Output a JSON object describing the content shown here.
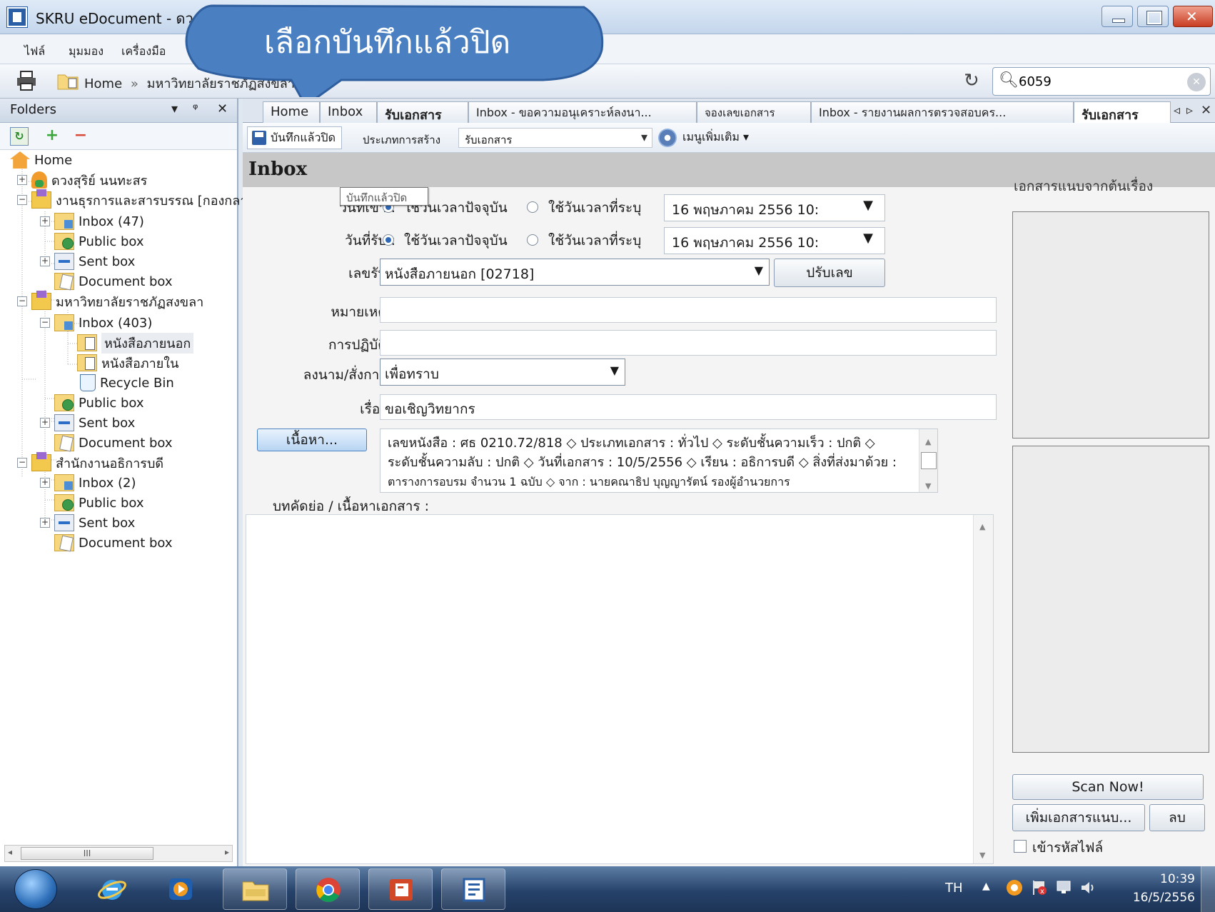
{
  "window": {
    "title": "SKRU eDocument - ดวงสุริย์ นนทะสร"
  },
  "menu": [
    "ไฟล์",
    "มุมมอง",
    "เครื่องมือ"
  ],
  "address": {
    "home": "Home",
    "separator": "»",
    "path": "มหาวิทยาลัยราชภัฏสงขลา",
    "search_value": "6059"
  },
  "callout": {
    "text": "เลือกบันทึกแล้วปิด"
  },
  "tooltip": "บันทึกแล้วปิด",
  "folders": {
    "title": "Folders",
    "tree": [
      {
        "label": "Home",
        "icon": "home-icon"
      },
      {
        "label": "ดวงสุริย์ นนทะสร",
        "icon": "user-icon"
      },
      {
        "label": "งานธุรการและสารบรรณ [กองกลาง]",
        "icon": "group-folder-icon"
      },
      {
        "label": "Inbox (47)",
        "icon": "inbox-icon"
      },
      {
        "label": "Public box",
        "icon": "public-box-icon"
      },
      {
        "label": "Sent box",
        "icon": "sent-box-icon"
      },
      {
        "label": "Document box",
        "icon": "document-box-icon"
      },
      {
        "label": "มหาวิทยาลัยราชภัฏสงขลา",
        "icon": "group-folder-icon"
      },
      {
        "label": "Inbox (403)",
        "icon": "inbox-icon"
      },
      {
        "label": "หนังสือภายนอก",
        "icon": "page-folder-icon"
      },
      {
        "label": "หนังสือภายใน",
        "icon": "page-folder-icon"
      },
      {
        "label": "Recycle Bin",
        "icon": "recycle-bin-icon"
      },
      {
        "label": "Public box",
        "icon": "public-box-icon"
      },
      {
        "label": "Sent box",
        "icon": "sent-box-icon"
      },
      {
        "label": "Document box",
        "icon": "document-box-icon"
      },
      {
        "label": "สำนักงานอธิการบดี",
        "icon": "group-folder-icon"
      },
      {
        "label": "Inbox (2)",
        "icon": "inbox-icon"
      },
      {
        "label": "Public box",
        "icon": "public-box-icon"
      },
      {
        "label": "Sent box",
        "icon": "sent-box-icon"
      },
      {
        "label": "Document box",
        "icon": "document-box-icon"
      }
    ],
    "hscroll_label": "III"
  },
  "tabs": [
    {
      "label": "Home"
    },
    {
      "label": "Inbox"
    },
    {
      "label": "รับเอกสาร"
    },
    {
      "label": "Inbox - ขอความอนุเคราะห์ลงนา..."
    },
    {
      "label": "จองเลขเอกสาร"
    },
    {
      "label": "Inbox - รายงานผลการตรวจสอบคร..."
    },
    {
      "label": "รับเอกสาร",
      "active": true
    }
  ],
  "toolbar": {
    "save_close": "บันทึกแล้วปิด",
    "create_type_label": "ประเภทการสร้าง",
    "create_type_value": "รับเอกสาร",
    "more_menu": "เมนูเพิ่มเติม"
  },
  "inbox_title": "Inbox",
  "form": {
    "date_in_label": "วันที่เข้า :",
    "date_recv_label": "วันที่รับ :",
    "use_now": "ใช้วันเวลาปัจจุบัน",
    "use_specified": "ใช้วันเวลาที่ระบุ",
    "date_in_value": "16  พฤษภาคม  2556  10:",
    "date_recv_value": "16  พฤษภาคม  2556  10:",
    "recv_no_label": "เลขรับ :",
    "recv_no_value": "หนังสือภายนอก [02718]",
    "adjust_no_button": "ปรับเลข",
    "note_label": "หมายเหตุ :",
    "note_value": "",
    "action_label": "การปฏิบัติ :",
    "action_value": "",
    "sign_label": "ลงนาม/สั่งการ :",
    "sign_value": "เพื่อทราบ",
    "subject_label": "เรื่อง :",
    "subject_value": "ขอเชิญวิทยากร",
    "content_button": "เนื้อหา...",
    "metadata_lines": [
      "เลขหนังสือ : ศธ 0210.72/818 ◇ ประเภทเอกสาร : ทั่วไป ◇ ระดับชั้นความเร็ว : ปกติ ◇",
      "ระดับชั้นความลับ : ปกติ ◇ วันที่เอกสาร : 10/5/2556 ◇ เรียน : อธิการบดี ◇ สิ่งที่ส่งมาด้วย :",
      "ตารางการอบรม จำนวน  1  ฉบับ ◇ จาก : นายคณาธิป  บุญญารัตน์ รองผู้อำนวยการ"
    ],
    "body_label": "บทคัดย่อ / เนื้อหาเอกสาร :"
  },
  "attachments": {
    "title": "เอกสารแนบจากต้นเรื่อง",
    "scan_button": "Scan Now!",
    "add_button": "เพิ่มเอกสารแนบ...",
    "delete_button": "ลบ",
    "encrypt_label": "เข้ารหัสไฟล์"
  },
  "taskbar": {
    "lang": "TH",
    "time": "10:39",
    "date": "16/5/2556"
  },
  "colors": {
    "callout_fill": "#4a7fc1",
    "taskbar": "#26426a",
    "inbox_header": "#c7c7c7"
  }
}
